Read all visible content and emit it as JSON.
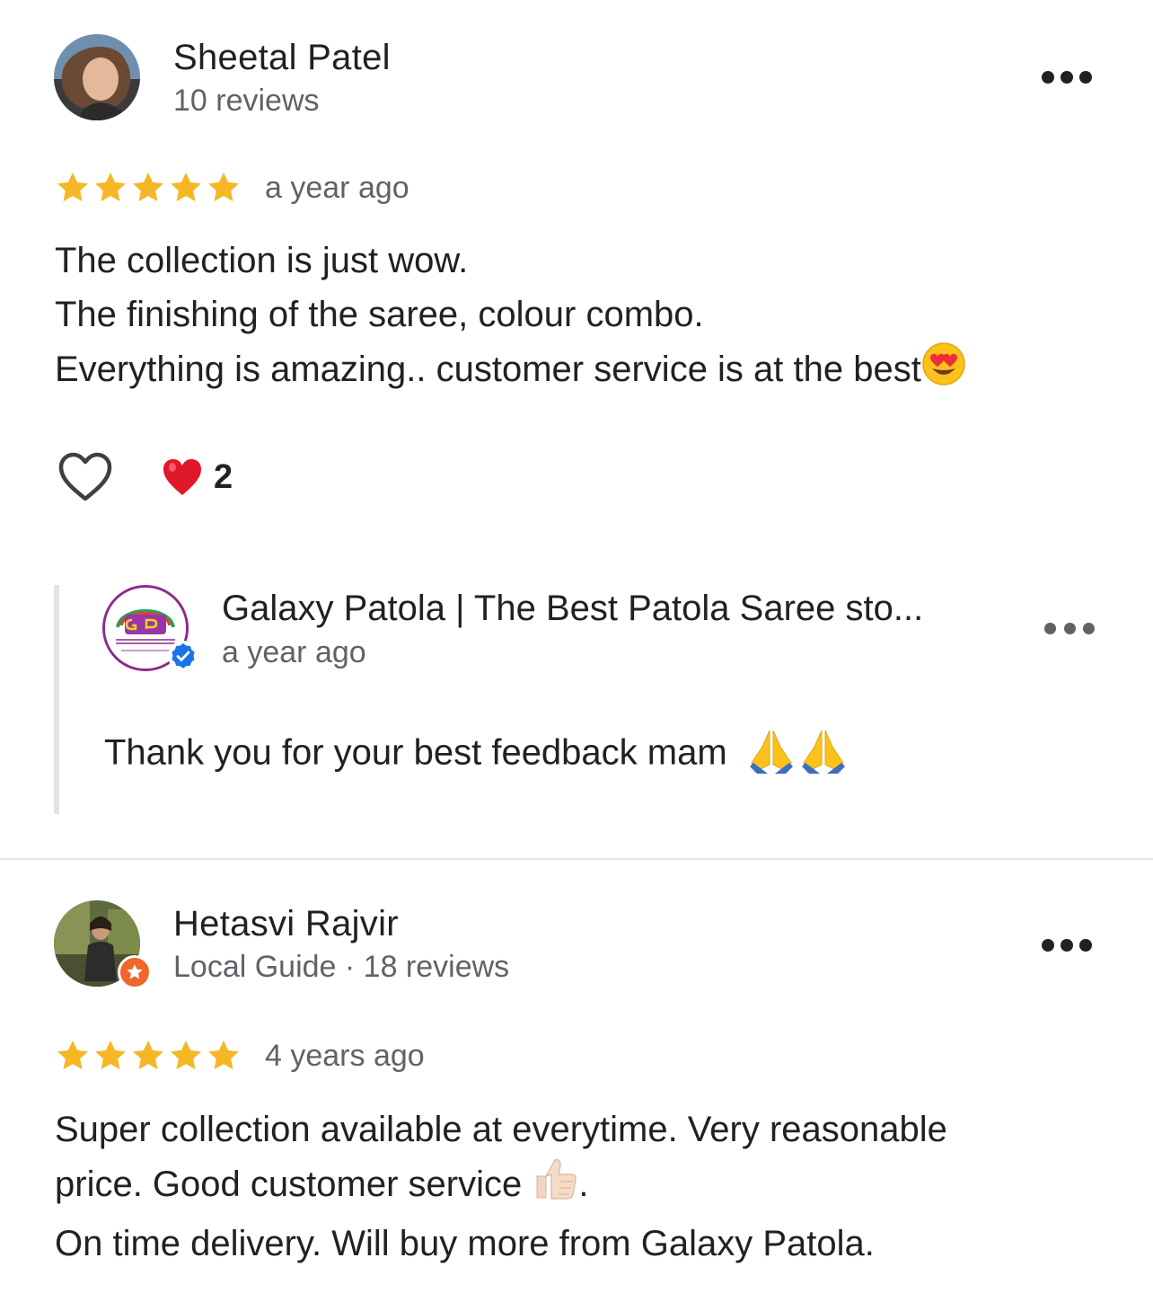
{
  "reviews": [
    {
      "reviewer_name": "Sheetal Patel",
      "reviewer_meta": "10 reviews",
      "rating": 5,
      "time": "a year ago",
      "lines": [
        "The collection is just wow.",
        "The finishing of the saree, colour combo.",
        "Everything is amazing.. customer service is at the best"
      ],
      "reaction_count": "2",
      "owner_reply": {
        "owner_name": "Galaxy Patola | The Best Patola Saree sto...",
        "time": "a year ago",
        "text": "Thank you for your best feedback mam"
      }
    },
    {
      "reviewer_name": "Hetasvi Rajvir",
      "reviewer_meta": "Local Guide · 18 reviews",
      "rating": 5,
      "time": "4 years ago",
      "lines": [
        "Super collection available at everytime. Very reasonable",
        "price. Good customer service",
        "On time delivery. Will buy more from Galaxy Patola."
      ]
    }
  ],
  "icons": {
    "star": "star-icon",
    "more": "more-horizontal-icon",
    "like": "heart-outline-icon",
    "reaction": "red-heart-icon",
    "verified": "verified-check-icon",
    "local_guide": "local-guide-star-icon"
  },
  "colors": {
    "star": "#f6b726",
    "text": "#202124",
    "secondary": "#5f6368",
    "divider": "#e3e3e3",
    "verified": "#1a73e8",
    "local_guide": "#f0672b"
  }
}
